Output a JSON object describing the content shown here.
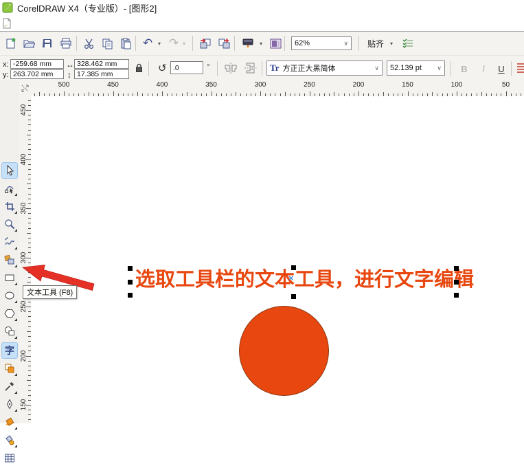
{
  "title_bar": {
    "title": "CorelDRAW X4（专业版）- [图形2]"
  },
  "toolbar": {
    "zoom_level": "62%",
    "snap_label": "贴齐",
    "undo_glyph": "↶",
    "redo_glyph": "↷",
    "dropdown_glyph": "▾",
    "combo_chevron": "∨"
  },
  "property_bar": {
    "x_label": "x:",
    "x_value": "-259.68 mm",
    "y_label": "y:",
    "y_value": "263.702 mm",
    "width_icon_glyph": "↔",
    "width_value": "328.462 mm",
    "height_icon_glyph": "↕",
    "height_value": "17.385 mm",
    "rotation_icon_glyph": "↺",
    "rotation_value": ".0",
    "degree_symbol": "°",
    "font_list_icon": "Tr",
    "font_name": "方正正大黑简体",
    "font_size_value": "52.139 pt",
    "bold_label": "B",
    "italic_label": "I",
    "underline_label": "U"
  },
  "toolbox": {
    "text_tool_label": "字",
    "tools": [
      "pick",
      "shape",
      "crop",
      "zoom",
      "freehand",
      "smart-fill",
      "rectangle",
      "ellipse",
      "polygon",
      "basic-shapes",
      "text",
      "interactive-blend",
      "eyedropper",
      "outline-pen",
      "fill",
      "interactive-fill",
      "table"
    ]
  },
  "rulers": {
    "horizontal_labels": [
      "500",
      "450",
      "400",
      "350",
      "300",
      "250",
      "200",
      "150",
      "100",
      "50"
    ],
    "vertical_labels": [
      "450",
      "400",
      "350",
      "300",
      "250",
      "200",
      "150"
    ]
  },
  "canvas": {
    "selected_text": "选取工具栏的文本工具，进行文字编辑",
    "text_color": "#e8470f",
    "circle_fill": "#e8470f",
    "tooltip_text": "文本工具 (F8)"
  },
  "colors": {
    "accent_orange": "#e8470f",
    "toolbar_bg": "#f4f3f0",
    "highlight_blue": "#c5e0f7",
    "arrow_red": "#e53026"
  }
}
